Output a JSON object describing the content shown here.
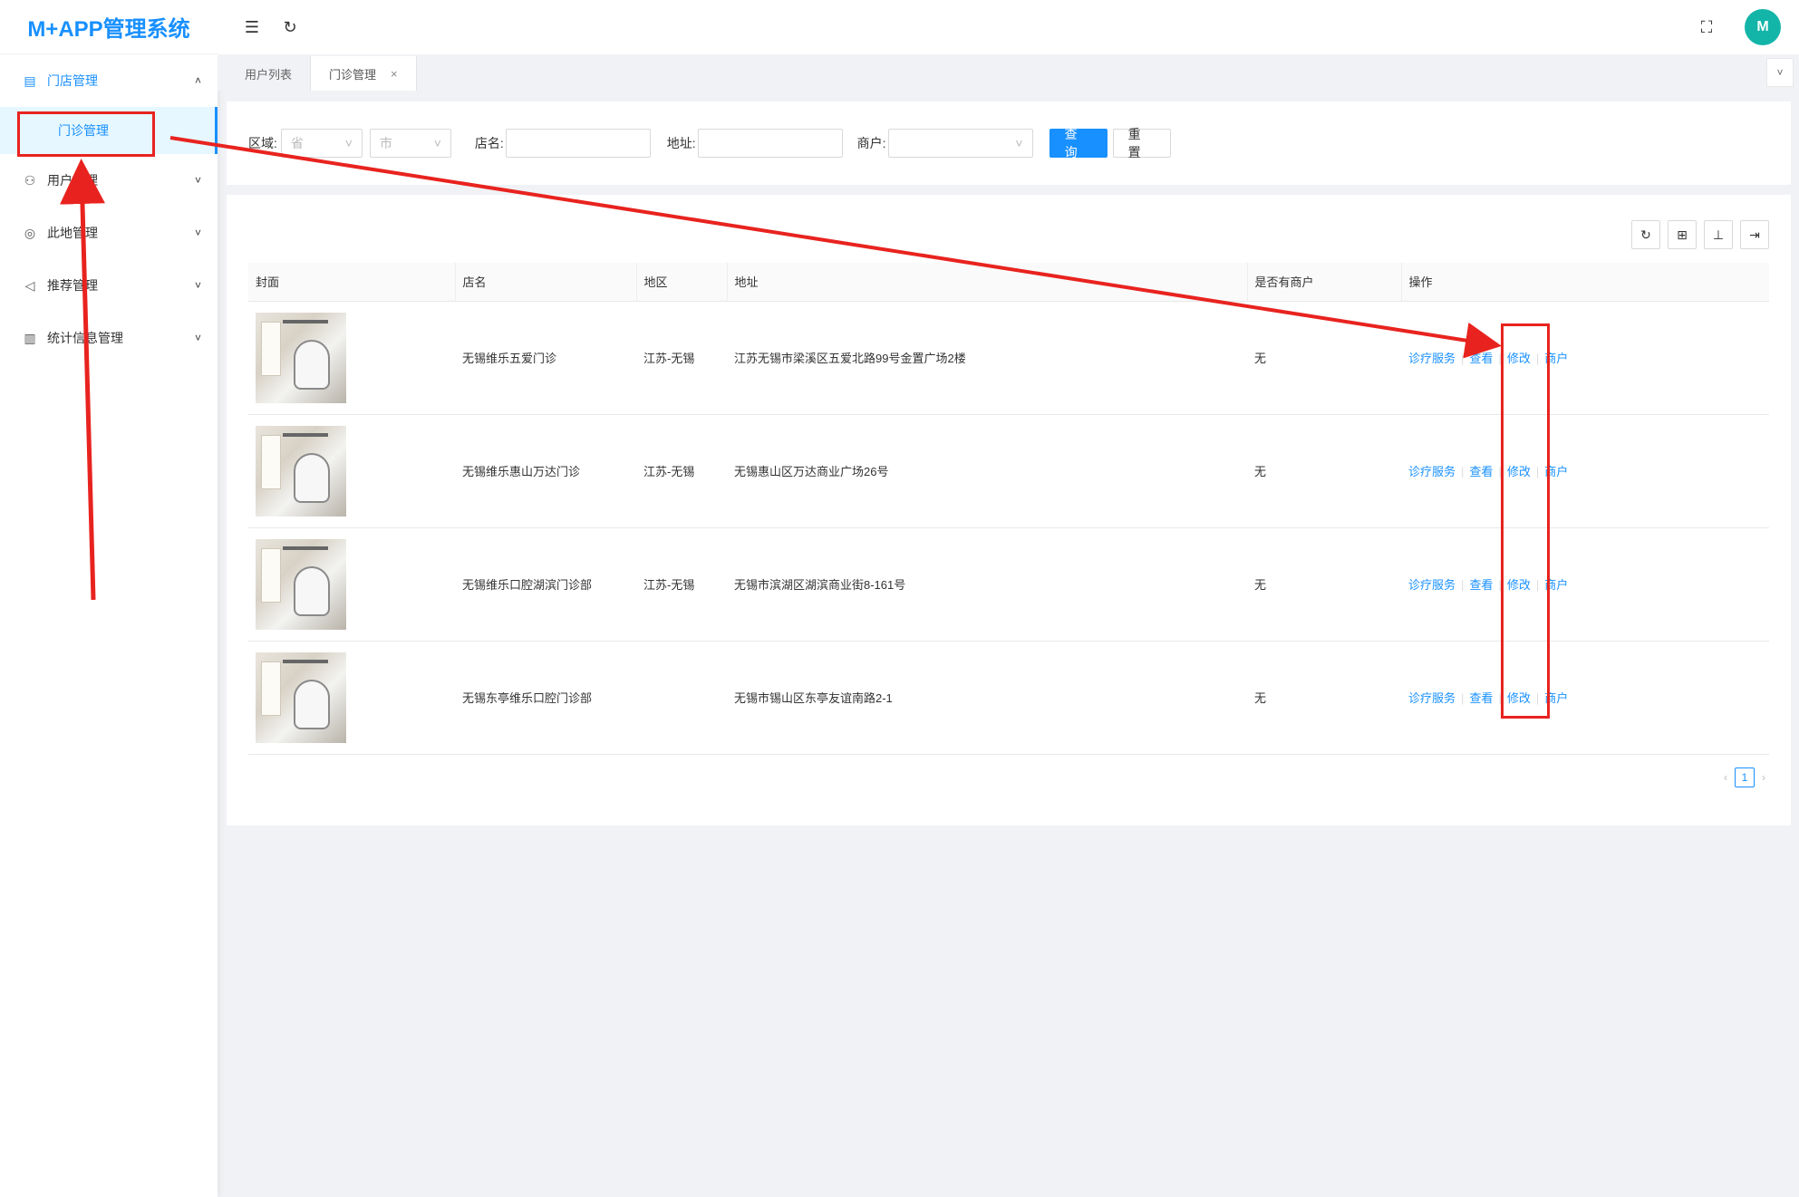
{
  "app": {
    "title": "M+APP管理系统"
  },
  "sidebar": {
    "items": [
      {
        "label": "门店管理",
        "icon": "store-icon",
        "open": true,
        "children": [
          {
            "label": "门诊管理"
          }
        ]
      },
      {
        "label": "用户管理",
        "icon": "user-icon"
      },
      {
        "label": "此地管理",
        "icon": "location-icon"
      },
      {
        "label": "推荐管理",
        "icon": "megaphone-icon"
      },
      {
        "label": "统计信息管理",
        "icon": "chart-icon"
      }
    ]
  },
  "header": {
    "collapse_icon": "menu-fold-icon",
    "refresh_icon": "refresh-icon",
    "fullscreen_icon": "fullscreen-icon",
    "avatar_text": "M"
  },
  "tabs": [
    {
      "label": "用户列表"
    },
    {
      "label": "门诊管理",
      "active": true,
      "close": "×"
    }
  ],
  "filter": {
    "region_label": "区域:",
    "province_placeholder": "省",
    "city_placeholder": "市",
    "store_label": "店名:",
    "address_label": "地址:",
    "merchant_label": "商户:",
    "search_button": "查 询",
    "reset_button": "重 置"
  },
  "table": {
    "columns": [
      "封面",
      "店名",
      "地区",
      "地址",
      "是否有商户",
      "操作"
    ],
    "actions": [
      "诊疗服务",
      "查看",
      "修改",
      "商户"
    ],
    "rows": [
      {
        "name": "无锡维乐五爱门诊",
        "region": "江苏-无锡",
        "address": "江苏无锡市梁溪区五爱北路99号金置广场2楼",
        "has_merchant": "无"
      },
      {
        "name": "无锡维乐惠山万达门诊",
        "region": "江苏-无锡",
        "address": "无锡惠山区万达商业广场26号",
        "has_merchant": "无"
      },
      {
        "name": "无锡维乐口腔湖滨门诊部",
        "region": "江苏-无锡",
        "address": "无锡市滨湖区湖滨商业街8-161号",
        "has_merchant": "无"
      },
      {
        "name": "无锡东亭维乐口腔门诊部",
        "region": "",
        "address": "无锡市锡山区东亭友谊南路2-1",
        "has_merchant": "无"
      }
    ]
  },
  "pager": {
    "current": "1",
    "prev": "‹",
    "next": "›"
  },
  "colors": {
    "accent": "#1890ff",
    "annotation": "#e8231f"
  }
}
